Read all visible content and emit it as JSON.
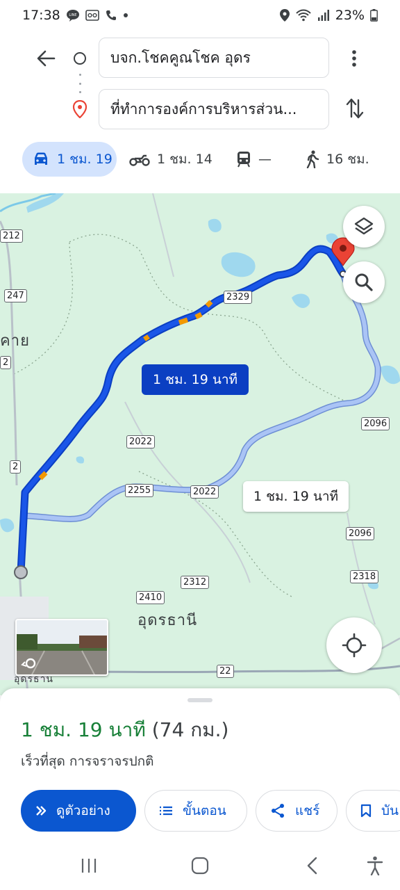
{
  "status_bar": {
    "time": "17:38",
    "battery": "23%"
  },
  "directions": {
    "origin": "บจก.โชคคูณโชค อุดร",
    "destination": "ที่ทำการองค์การบริหารส่วน...",
    "modes": [
      {
        "icon": "car-icon",
        "label": "1 ชม. 19"
      },
      {
        "icon": "motorcycle-icon",
        "label": "1 ชม. 14"
      },
      {
        "icon": "transit-icon",
        "label": "—"
      },
      {
        "icon": "walk-icon",
        "label": "16 ชม."
      }
    ]
  },
  "map": {
    "route_primary_label": "1 ชม. 19 นาที",
    "route_alt_label": "1 ชม. 19 นาที",
    "place_labels": [
      "คาย",
      "อุดรธานี",
      "อุดรธาน"
    ],
    "road_shields": [
      "212",
      "247",
      "2",
      "2",
      "2329",
      "2022",
      "2255",
      "2022",
      "2096",
      "2096",
      "2312",
      "2410",
      "2318",
      "22"
    ],
    "colors": {
      "route_primary": "#1a56e8",
      "route_alt": "#aac4f5",
      "traffic_slow": "#f29900",
      "destination_pin": "#ea4335"
    }
  },
  "sheet": {
    "duration": "1 ชม. 19 นาที",
    "distance": "(74 กม.)",
    "subtitle": "เร็วที่สุด การจราจรปกติ",
    "actions": {
      "preview": "ดูตัวอย่าง",
      "steps": "ขั้นตอน",
      "share": "แชร์",
      "save": "บัน"
    }
  }
}
